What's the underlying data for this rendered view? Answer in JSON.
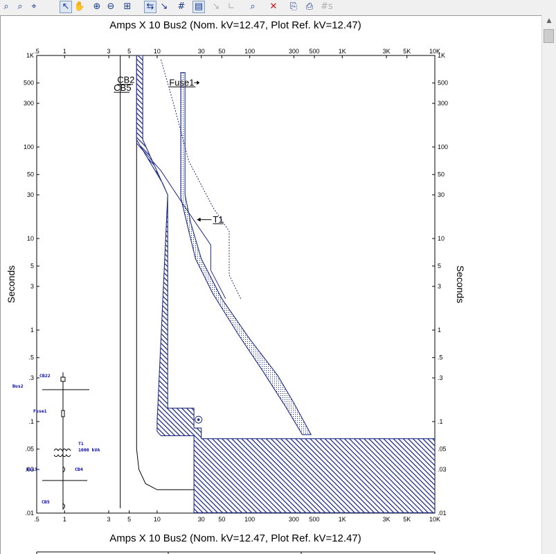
{
  "toolbar": {
    "buttons": [
      {
        "name": "zoom-to-fit-icon",
        "glyph": "⌕",
        "active": false,
        "disabled": false
      },
      {
        "name": "zoom-to-plot-icon",
        "glyph": "⌕",
        "active": false,
        "disabled": false
      },
      {
        "name": "zoom-to-component-icon",
        "glyph": "⌖",
        "active": false,
        "disabled": false
      },
      {
        "name": "select-pointer-icon",
        "glyph": "↖",
        "active": true,
        "disabled": false
      },
      {
        "name": "pan-hand-icon",
        "glyph": "✋",
        "active": false,
        "disabled": false
      },
      {
        "name": "zoom-in-icon",
        "glyph": "⊕",
        "active": false,
        "disabled": false
      },
      {
        "name": "zoom-out-icon",
        "glyph": "⊖",
        "active": false,
        "disabled": false
      },
      {
        "name": "fit-window-icon",
        "glyph": "⊞",
        "active": false,
        "disabled": false
      },
      {
        "name": "plot-options-icon",
        "glyph": "⇆",
        "active": true,
        "disabled": false
      },
      {
        "name": "axis-icon",
        "glyph": "↘",
        "active": false,
        "disabled": false
      },
      {
        "name": "grid-icon",
        "glyph": "#",
        "active": false,
        "disabled": false
      },
      {
        "name": "legend-icon",
        "glyph": "▤",
        "active": true,
        "disabled": false
      },
      {
        "name": "tcc-clipping-icon",
        "glyph": "↘",
        "active": false,
        "disabled": true
      },
      {
        "name": "step-icon",
        "glyph": "∟",
        "active": false,
        "disabled": true
      },
      {
        "name": "print-preview-icon",
        "glyph": "⌕",
        "active": false,
        "disabled": false
      },
      {
        "name": "delete-icon",
        "glyph": "✕",
        "active": false,
        "disabled": false
      },
      {
        "name": "copy-icon",
        "glyph": "⎘",
        "active": false,
        "disabled": false
      },
      {
        "name": "paste-icon",
        "glyph": "⎙",
        "active": false,
        "disabled": false
      },
      {
        "name": "show-settings-icon",
        "glyph": "#s",
        "active": false,
        "disabled": true
      }
    ]
  },
  "chart_data": {
    "type": "line",
    "title": "Amps  X  10    Bus2 (Nom. kV=12.47, Plot Ref. kV=12.47)",
    "bottom_title": "Amps  X  10    Bus2 (Nom. kV=12.47, Plot Ref. kV=12.47)",
    "xlabel": "Amps X 10",
    "ylabel": "Seconds",
    "x_scale": "log",
    "y_scale": "log",
    "xlim": [
      0.5,
      10000
    ],
    "ylim": [
      0.01,
      1000
    ],
    "grid": false,
    "x_ticks": [
      {
        "v": 0.5,
        "label": ".5"
      },
      {
        "v": 1,
        "label": "1"
      },
      {
        "v": 3,
        "label": "3"
      },
      {
        "v": 5,
        "label": "5"
      },
      {
        "v": 10,
        "label": "10"
      },
      {
        "v": 30,
        "label": "30"
      },
      {
        "v": 50,
        "label": "50"
      },
      {
        "v": 100,
        "label": "100"
      },
      {
        "v": 300,
        "label": "300"
      },
      {
        "v": 500,
        "label": "500"
      },
      {
        "v": 1000,
        "label": "1K"
      },
      {
        "v": 3000,
        "label": "3K"
      },
      {
        "v": 5000,
        "label": "5K"
      },
      {
        "v": 10000,
        "label": "10K"
      }
    ],
    "y_ticks": [
      {
        "v": 1000,
        "label": "1K"
      },
      {
        "v": 500,
        "label": "500"
      },
      {
        "v": 300,
        "label": "300"
      },
      {
        "v": 100,
        "label": "100"
      },
      {
        "v": 50,
        "label": "50"
      },
      {
        "v": 30,
        "label": "30"
      },
      {
        "v": 10,
        "label": "10"
      },
      {
        "v": 5,
        "label": "5"
      },
      {
        "v": 3,
        "label": "3"
      },
      {
        "v": 1,
        "label": "1"
      },
      {
        "v": 0.5,
        "label": ".5"
      },
      {
        "v": 0.3,
        "label": ".3"
      },
      {
        "v": 0.1,
        "label": ".1"
      },
      {
        "v": 0.05,
        "label": ".05"
      },
      {
        "v": 0.03,
        "label": ".03"
      },
      {
        "v": 0.01,
        "label": ".01"
      }
    ],
    "series": [
      {
        "name": "CB5 curve",
        "kind": "line",
        "color": "#000000",
        "points": [
          [
            4,
            1000
          ],
          [
            4,
            0.0113
          ]
        ]
      },
      {
        "name": "CB22 inner curve",
        "kind": "line",
        "color": "#000000",
        "points": [
          [
            6,
            1000
          ],
          [
            6,
            0.05
          ],
          [
            6.35,
            0.03
          ],
          [
            7.5,
            0.021
          ],
          [
            10,
            0.018
          ],
          [
            25,
            0.018
          ]
        ]
      },
      {
        "name": "CB22 band",
        "kind": "band",
        "color": "#1f2c84",
        "points": [
          [
            6,
            1000
          ],
          [
            7,
            1000
          ],
          [
            7,
            120
          ],
          [
            13,
            30
          ],
          [
            13,
            0.14
          ],
          [
            25,
            0.14
          ],
          [
            25,
            0.085
          ],
          [
            30,
            0.085
          ],
          [
            30,
            0.065
          ],
          [
            10000,
            0.065
          ],
          [
            10000,
            0.0101
          ],
          [
            25,
            0.0101
          ],
          [
            25,
            0.07
          ],
          [
            11,
            0.07
          ],
          [
            10,
            0.078
          ],
          [
            10,
            0.1
          ],
          [
            13,
            30
          ],
          [
            11.5,
            40
          ],
          [
            6,
            120
          ]
        ]
      },
      {
        "name": "Fuse1 band",
        "kind": "band",
        "color": "#1f2c84",
        "points": [
          [
            20,
            650
          ],
          [
            20,
            30
          ],
          [
            23,
            15
          ],
          [
            30,
            6
          ],
          [
            50,
            2.2
          ],
          [
            100,
            0.8
          ],
          [
            200,
            0.32
          ],
          [
            300,
            0.16
          ],
          [
            460,
            0.072
          ],
          [
            370,
            0.072
          ],
          [
            250,
            0.14
          ],
          [
            140,
            0.35
          ],
          [
            75,
            0.9
          ],
          [
            40,
            2.5
          ],
          [
            26,
            6
          ],
          [
            22,
            12
          ],
          [
            18,
            28
          ],
          [
            18,
            650
          ]
        ]
      },
      {
        "name": "T1 curve",
        "kind": "line",
        "color": "#1f2c84",
        "points": [
          [
            6,
            110
          ],
          [
            11,
            55
          ],
          [
            20,
            22
          ],
          [
            38,
            8.5
          ],
          [
            38,
            4.5
          ],
          [
            55,
            2.2
          ]
        ]
      },
      {
        "name": "T1 damage curve",
        "kind": "line",
        "color": "#1f2c84",
        "dashed": true,
        "points": [
          [
            11,
            900
          ],
          [
            15,
            300
          ],
          [
            22,
            70
          ],
          [
            40,
            22
          ],
          [
            60,
            12
          ],
          [
            60,
            4
          ],
          [
            80,
            2.2
          ]
        ]
      }
    ],
    "labels": [
      {
        "text": "CB2",
        "x": 3.7,
        "y": 500,
        "underline": true
      },
      {
        "text": "CB5",
        "x": 3.4,
        "y": 410,
        "underline": true
      },
      {
        "text": "Fuse1",
        "x": 13.5,
        "y": 470,
        "underline": true
      },
      {
        "text": "T1",
        "x": 40,
        "y": 15,
        "underline": true
      }
    ],
    "marker": {
      "x": 28,
      "y": 0.105,
      "symbol": "circled-dot"
    }
  },
  "one_line": {
    "bus_top": "Bus2",
    "cb_top": "CB22",
    "fuse": "Fuse1",
    "transformer": "T1",
    "transformer_rating": "1000 kVA",
    "bus_bottom": "Bus3",
    "cb_mid": "CB4",
    "cb_bottom": "CB5"
  }
}
